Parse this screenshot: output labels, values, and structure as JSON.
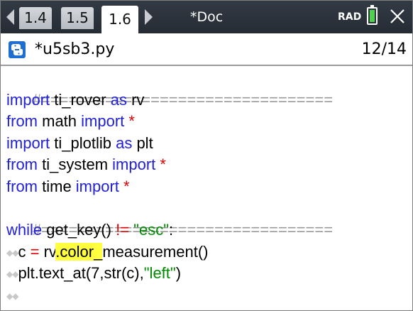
{
  "tabs": [
    {
      "label": "1.4"
    },
    {
      "label": "1.5"
    },
    {
      "label": "1.6"
    }
  ],
  "doc_title": "*Doc",
  "mode": "RAD",
  "icons": {
    "nav_left": "chevron-left-icon",
    "nav_right": "chevron-right-icon",
    "battery": "battery-icon",
    "close": "close-icon",
    "file": "python-file-icon"
  },
  "colors": {
    "topbar": "#2b313a",
    "keyword": "#2020d8",
    "operator": "#e00000",
    "string": "#008a00",
    "comment": "#9a9a9a",
    "highlight": "#ffff40",
    "battery": "#4fd34f"
  },
  "file": {
    "name": "*u5sb3.py",
    "position": "12/14"
  },
  "code": {
    "line1": "#================================",
    "line2": {
      "kw1": "import",
      "t1": " ti_rover ",
      "kw2": "as",
      "t2": " rv"
    },
    "line3": {
      "kw1": "from",
      "t1": " math ",
      "kw2": "import",
      "op": " *"
    },
    "line4": {
      "kw1": "import",
      "t1": " ti_plotlib ",
      "kw2": "as",
      "t2": " plt"
    },
    "line5": {
      "kw1": "from",
      "t1": " ti_system ",
      "kw2": "import",
      "op": " *"
    },
    "line6": {
      "kw1": "from",
      "t1": " time ",
      "kw2": "import",
      "op": " *"
    },
    "line7": "#================================",
    "line8": {
      "kw1": "while",
      "t1": " get_key() ",
      "op": "!=",
      "t2": " ",
      "str": "\"esc\"",
      "t3": ":"
    },
    "line9": {
      "indent": "◆◆",
      "t1": "c ",
      "op": "=",
      "t2": " rv",
      "hl": ".color_",
      "t3": "measurement()"
    },
    "line10": {
      "indent": "◆◆",
      "t1": "plt.text_at(7,str(c),",
      "str": "\"left\"",
      "t2": ")"
    },
    "line11": {
      "indent": "◆◆"
    }
  }
}
